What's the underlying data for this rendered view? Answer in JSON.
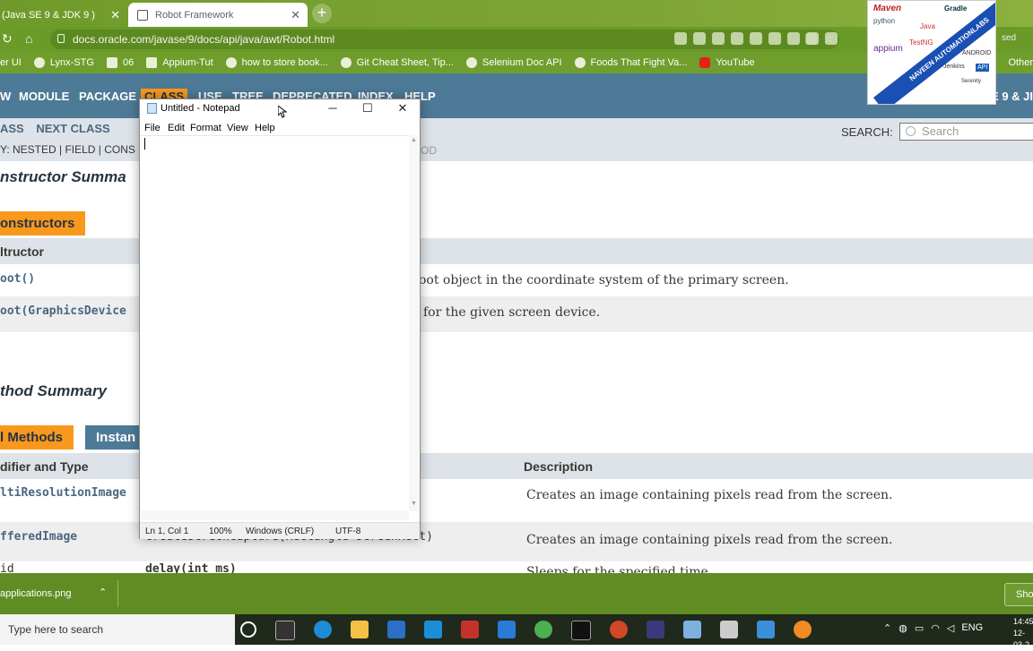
{
  "browser": {
    "tabs": [
      {
        "title": "(Java SE 9 & JDK 9 )"
      },
      {
        "title": "Robot Framework"
      }
    ],
    "url": "docs.oracle.com/javase/9/docs/api/java/awt/Robot.html",
    "bookmarks": [
      "er UI",
      "Lynx-STG",
      "06",
      "Appium-Tut",
      "how to store book...",
      "Git Cheat Sheet, Tip...",
      "Selenium Doc API",
      "Foods That Fight Va...",
      "YouTube"
    ],
    "bookmarks_other": "Other",
    "profile_status": "sed"
  },
  "javadoc": {
    "nav": [
      "W",
      "MODULE",
      "PACKAGE",
      "CLASS",
      "USE",
      "TREE",
      "DEPRECATED",
      "INDEX",
      "HELP"
    ],
    "brand": "E 9 & JI",
    "subnav_row1": [
      "ASS",
      "NEXT CLASS"
    ],
    "subnav_row2": "Y: NESTED | FIELD | CONS",
    "subnav_row2_tail": "OD",
    "search_label": "SEARCH:",
    "search_placeholder": "Search",
    "constructor_summary_title": "nstructor Summa",
    "constructors_tab": "onstructors",
    "constructor_header": "ltructor",
    "constructors": [
      {
        "name": "oot()",
        "desc": "oot object in the coordinate system of the primary screen."
      },
      {
        "name": "oot(GraphicsDevice",
        "desc": "for the given screen device."
      }
    ],
    "method_summary_title": "thod Summary",
    "methods_tab": "l Methods",
    "instance_tab": "Instan",
    "col_modifier": "difier and Type",
    "col_description": "Description",
    "methods": [
      {
        "type": "ltiResolutionImage",
        "sig": "",
        "desc": "Creates an image containing pixels read from the screen."
      },
      {
        "type": "fferedImage",
        "sig": "createScreenCapture(Rectangle screenRect)",
        "desc": "Creates an image containing pixels read from the screen."
      },
      {
        "type": "id",
        "sig": "delay(int ms)",
        "desc": "Sleeps for the specified time."
      }
    ]
  },
  "notepad": {
    "title": "Untitled - Notepad",
    "menu": [
      "File",
      "Edit",
      "Format",
      "View",
      "Help"
    ],
    "content": "",
    "status": {
      "position": "Ln 1, Col 1",
      "zoom": "100%",
      "line_endings": "Windows (CRLF)",
      "encoding": "UTF-8"
    }
  },
  "downloads": {
    "file": "applications.png",
    "show_all": "Sho"
  },
  "taskbar": {
    "search_placeholder": "Type here to search",
    "tray_lang": "ENG",
    "clock_time": "14:45",
    "clock_date": "12-03-2"
  },
  "logo_text": [
    "Maven",
    "Gradle",
    "python",
    "Java",
    "appium",
    "TestNG",
    "ANDROID",
    "Jenkins",
    "API",
    "Serenity",
    "NAVEEN AUTOMATIONLABS"
  ],
  "colors": {
    "javadoc_nav": "#4d7a97",
    "javadoc_active": "#f8981d",
    "browser_theme": "#6f9e2c"
  }
}
